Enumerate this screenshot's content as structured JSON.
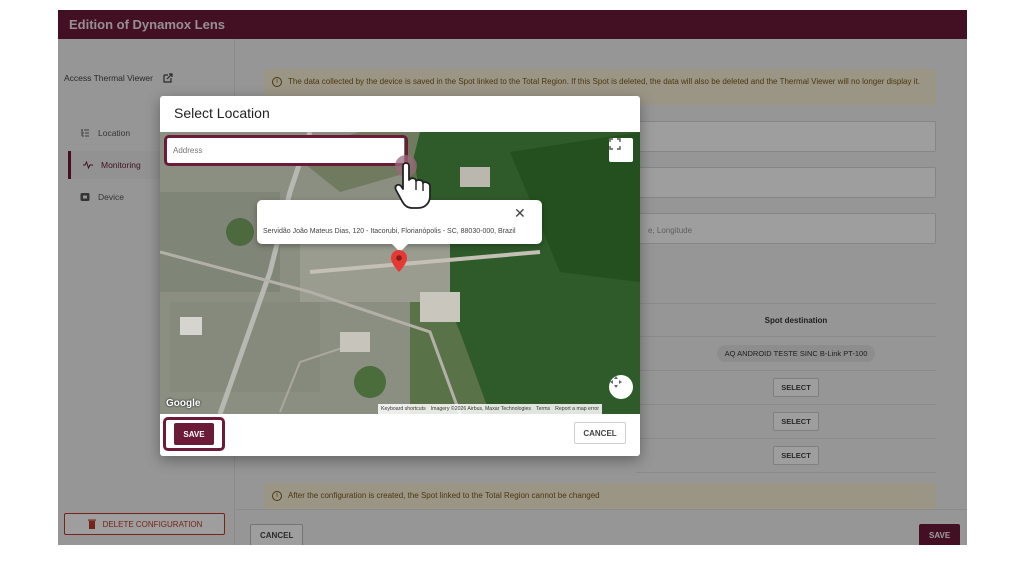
{
  "window": {
    "title": "Edition of Dynamox Lens"
  },
  "sidebar": {
    "access_link": "Access Thermal Viewer",
    "items": [
      {
        "label": "Location",
        "icon": "tree-list-icon"
      },
      {
        "label": "Monitoring",
        "icon": "pulse-icon",
        "active": true
      },
      {
        "label": "Device",
        "icon": "device-icon"
      }
    ],
    "delete_button": "DELETE CONFIGURATION"
  },
  "content": {
    "top_notice": "The data collected by the device is saved in the Spot linked to the Total Region. If this Spot is deleted, the data will also be deleted and the Thermal Viewer will no longer display it.",
    "lat_long_hint": "e, Longitude",
    "spot_table": {
      "header": "Spot destination",
      "rows": [
        {
          "type": "chip",
          "text": "AQ ANDROID TESTE SINC B-Link PT-100"
        },
        {
          "type": "button",
          "text": "SELECT"
        },
        {
          "type": "button",
          "text": "SELECT"
        },
        {
          "type": "button",
          "text": "SELECT"
        }
      ]
    },
    "bottom_notice": "After the configuration is created, the Spot linked to the Total Region cannot be changed",
    "cancel_button": "CANCEL",
    "save_button": "SAVE"
  },
  "modal": {
    "title": "Select Location",
    "address_placeholder": "Address",
    "popup_address": "Servidão João Mateus Dias, 120 - Itacorubi, Florianópolis - SC, 88030-000, Brazil",
    "google_label": "Google",
    "attribution": [
      "Keyboard shortcuts",
      "Imagery ©2026 Airbus, Maxar Technologies",
      "Terms",
      "Report a map error"
    ],
    "save_button": "SAVE",
    "cancel_button": "CANCEL"
  },
  "colors": {
    "brand": "#6b1a37",
    "notice_bg": "#fbf1d8",
    "danger": "#c0392b"
  }
}
